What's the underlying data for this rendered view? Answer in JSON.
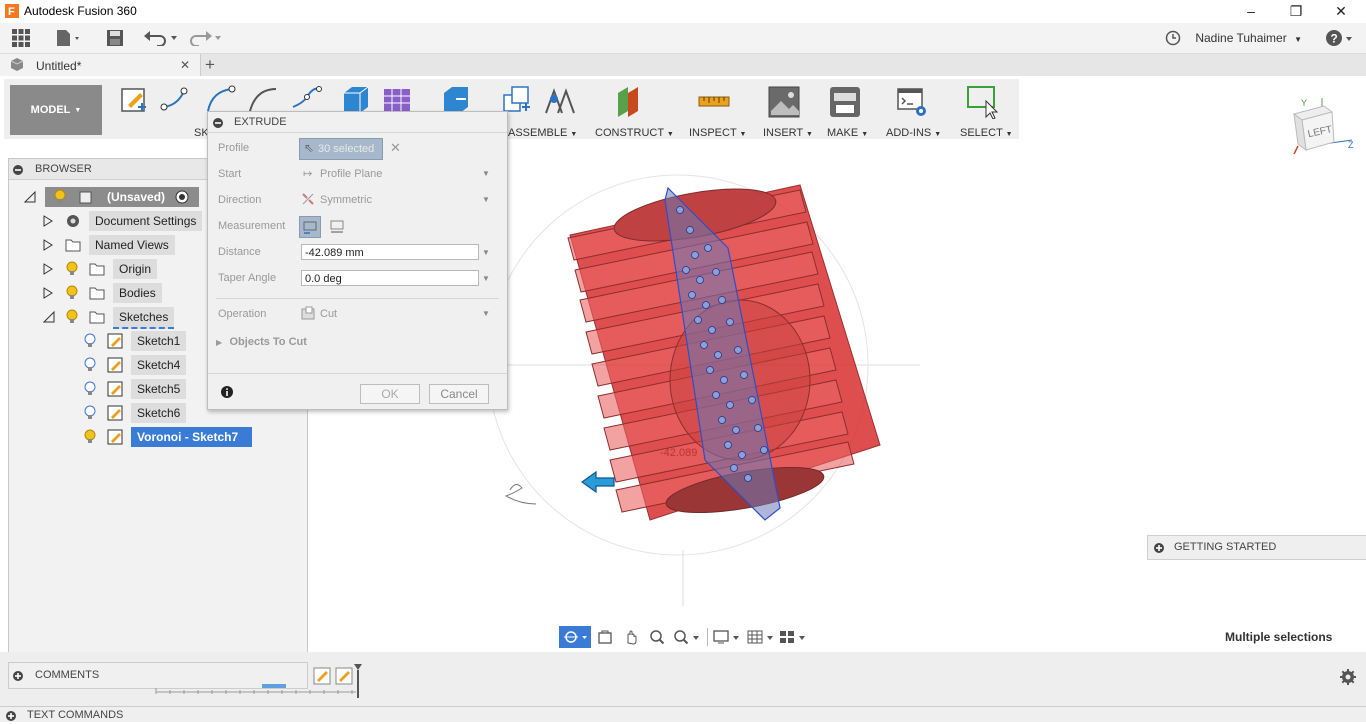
{
  "app": {
    "title": "Autodesk Fusion 360"
  },
  "window_controls": {
    "minimize": "–",
    "restore": "❐",
    "close": "✕"
  },
  "user": {
    "name": "Nadine Tuhaimer",
    "help": "?"
  },
  "document": {
    "tab_title": "Untitled*",
    "close": "✕",
    "new_tab": "+"
  },
  "workspace": {
    "label": "MODEL"
  },
  "ribbon": {
    "groups": [
      {
        "label": "SK"
      },
      {
        "label": "ASSEMBLE"
      },
      {
        "label": "CONSTRUCT"
      },
      {
        "label": "INSPECT"
      },
      {
        "label": "INSERT"
      },
      {
        "label": "MAKE"
      },
      {
        "label": "ADD-INS"
      },
      {
        "label": "SELECT"
      }
    ]
  },
  "browser": {
    "title": "BROWSER",
    "root": "(Unsaved)",
    "items": [
      {
        "label": "Document Settings",
        "icon": "gear-icon"
      },
      {
        "label": "Named Views",
        "icon": "folder-icon"
      },
      {
        "label": "Origin",
        "icon": "folder-icon"
      },
      {
        "label": "Bodies",
        "icon": "folder-icon"
      },
      {
        "label": "Sketches",
        "icon": "folder-icon"
      }
    ],
    "sketches": [
      {
        "label": "Sketch1"
      },
      {
        "label": "Sketch4"
      },
      {
        "label": "Sketch5"
      },
      {
        "label": "Sketch6"
      },
      {
        "label": "Voronoi - Sketch7"
      }
    ]
  },
  "extrude": {
    "title": "EXTRUDE",
    "profile_label": "Profile",
    "profile_value": "30 selected",
    "start_label": "Start",
    "start_value": "Profile Plane",
    "direction_label": "Direction",
    "direction_value": "Symmetric",
    "measurement_label": "Measurement",
    "distance_label": "Distance",
    "distance_value": "-42.089 mm",
    "taper_label": "Taper Angle",
    "taper_value": "0.0 deg",
    "operation_label": "Operation",
    "operation_value": "Cut",
    "objects_label": "Objects To Cut",
    "ok": "OK",
    "cancel": "Cancel"
  },
  "viewcube": {
    "face": "LEFT",
    "axis_y": "Y",
    "axis_z": "Z"
  },
  "canvas": {
    "dimension_text": "-42.089"
  },
  "panels": {
    "comments": "COMMENTS",
    "getting_started": "GETTING STARTED",
    "text_commands": "TEXT COMMANDS"
  },
  "status": {
    "selection": "Multiple selections"
  },
  "colors": {
    "accent_blue": "#2b73c2",
    "selected_blue": "#3a7bd5",
    "body_red": "#e8191a"
  }
}
